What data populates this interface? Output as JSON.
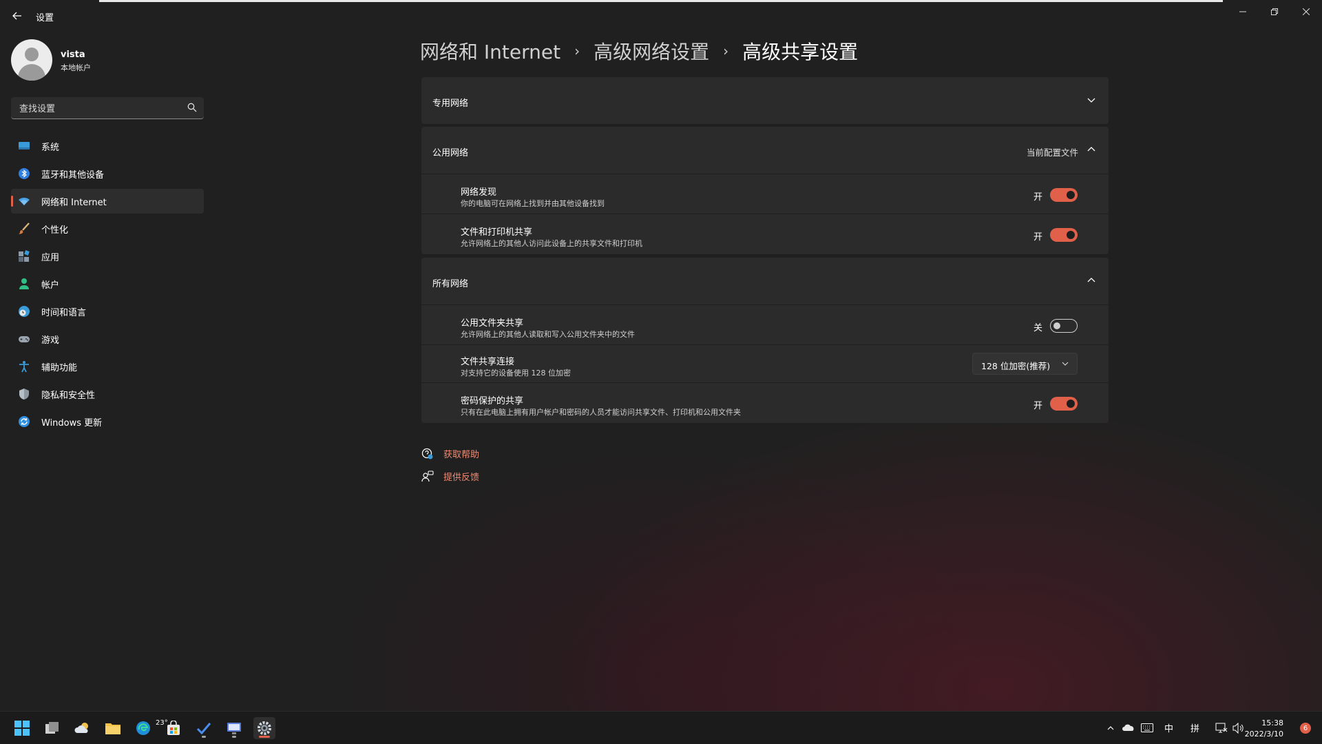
{
  "window": {
    "title": "设置",
    "back_icon": "arrow-left-icon",
    "controls": [
      "minimize-icon",
      "restore-icon",
      "close-icon"
    ]
  },
  "user": {
    "name": "vista",
    "account_type": "本地帐户"
  },
  "search": {
    "placeholder": "查找设置",
    "icon": "search-icon"
  },
  "sidebar": {
    "items": [
      {
        "label": "系统",
        "icon": "monitor-icon",
        "active": false
      },
      {
        "label": "蓝牙和其他设备",
        "icon": "bluetooth-icon",
        "active": false
      },
      {
        "label": "网络和 Internet",
        "icon": "wifi-icon",
        "active": true
      },
      {
        "label": "个性化",
        "icon": "brush-icon",
        "active": false
      },
      {
        "label": "应用",
        "icon": "apps-icon",
        "active": false
      },
      {
        "label": "帐户",
        "icon": "person-icon",
        "active": false
      },
      {
        "label": "时间和语言",
        "icon": "globe-clock-icon",
        "active": false
      },
      {
        "label": "游戏",
        "icon": "gamepad-icon",
        "active": false
      },
      {
        "label": "辅助功能",
        "icon": "accessibility-icon",
        "active": false
      },
      {
        "label": "隐私和安全性",
        "icon": "shield-icon",
        "active": false
      },
      {
        "label": "Windows 更新",
        "icon": "update-icon",
        "active": false
      }
    ]
  },
  "breadcrumb": {
    "items": [
      "网络和 Internet",
      "高级网络设置",
      "高级共享设置"
    ],
    "separator": "›"
  },
  "sections": {
    "private": {
      "title": "专用网络",
      "expanded": false
    },
    "public": {
      "title": "公用网络",
      "note": "当前配置文件",
      "expanded": true,
      "rows": [
        {
          "title": "网络发现",
          "subtitle": "你的电脑可在网络上找到并由其他设备找到",
          "state_label": "开",
          "on": true
        },
        {
          "title": "文件和打印机共享",
          "subtitle": "允许网络上的其他人访问此设备上的共享文件和打印机",
          "state_label": "开",
          "on": true
        }
      ]
    },
    "all": {
      "title": "所有网络",
      "expanded": true,
      "rows": [
        {
          "title": "公用文件夹共享",
          "subtitle": "允许网络上的其他人读取和写入公用文件夹中的文件",
          "state_label": "关",
          "on": false
        },
        {
          "title": "文件共享连接",
          "subtitle": "对支持它的设备使用 128 位加密",
          "dropdown_value": "128 位加密(推荐)"
        },
        {
          "title": "密码保护的共享",
          "subtitle": "只有在此电脑上拥有用户帐户和密码的人员才能访问共享文件、打印机和公用文件夹",
          "state_label": "开",
          "on": true
        }
      ]
    }
  },
  "links": {
    "help": {
      "label": "获取帮助",
      "icon": "help-chat-icon"
    },
    "feedback": {
      "label": "提供反馈",
      "icon": "feedback-icon"
    }
  },
  "taskbar": {
    "weather_temp": "23°",
    "tray": {
      "ime_lang": "中",
      "ime_mode": "拼"
    },
    "clock": {
      "time": "15:38",
      "date": "2022/3/10"
    },
    "notification_count": "6"
  },
  "colors": {
    "accent": "#e0604a",
    "link": "#f08a72",
    "panel": "#2b2b2b",
    "background": "#202020"
  }
}
